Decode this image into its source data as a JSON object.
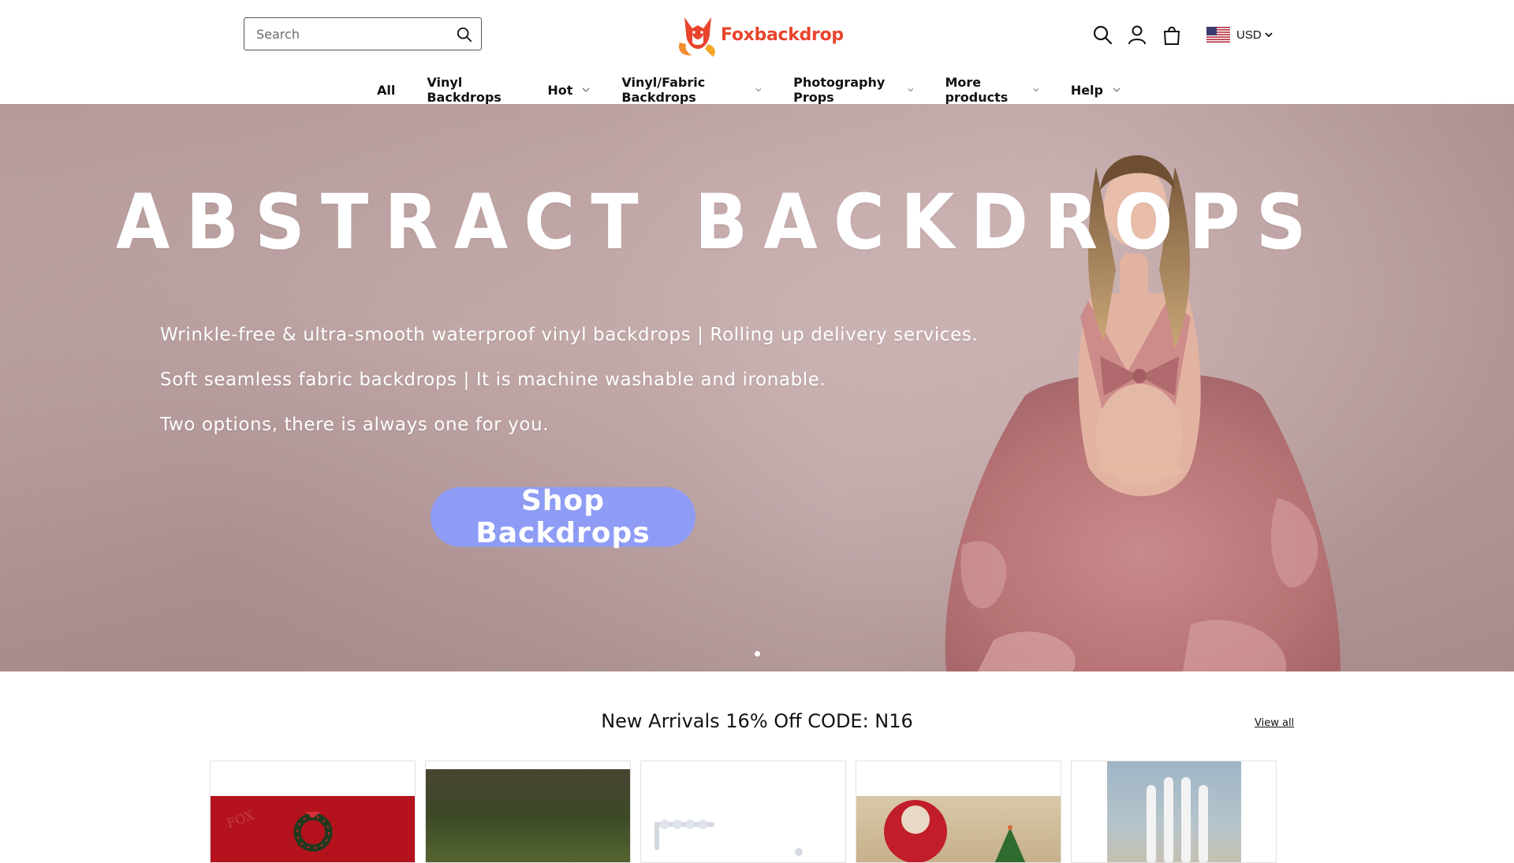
{
  "search": {
    "placeholder": "Search"
  },
  "brand": {
    "name": "Foxbackdrop",
    "color": "#e8452c"
  },
  "header_icons": [
    "search-icon",
    "account-icon",
    "cart-icon"
  ],
  "currency": {
    "code": "USD"
  },
  "nav": {
    "items": [
      {
        "label": "All",
        "dropdown": false
      },
      {
        "label": "Vinyl Backdrops",
        "dropdown": false
      },
      {
        "label": "Hot",
        "dropdown": true
      },
      {
        "label": "Vinyl/Fabric Backdrops",
        "dropdown": true
      },
      {
        "label": "Photography Props",
        "dropdown": true
      },
      {
        "label": "More products",
        "dropdown": true
      },
      {
        "label": "Help",
        "dropdown": true
      }
    ]
  },
  "hero": {
    "title": "ABSTRACT BACKDROPS",
    "lines": [
      "Wrinkle-free & ultra-smooth waterproof vinyl backdrops | Rolling up delivery services.",
      "Soft seamless fabric backdrops | It is machine washable and ironable.",
      "Two options, there is always one for you."
    ],
    "button_label": "Shop Backdrops",
    "button_color": "#8e9cf5"
  },
  "new_arrivals": {
    "title": "New Arrivals 16% Off CODE: N16",
    "view_all_label": "View all",
    "watermark": "FOX"
  }
}
